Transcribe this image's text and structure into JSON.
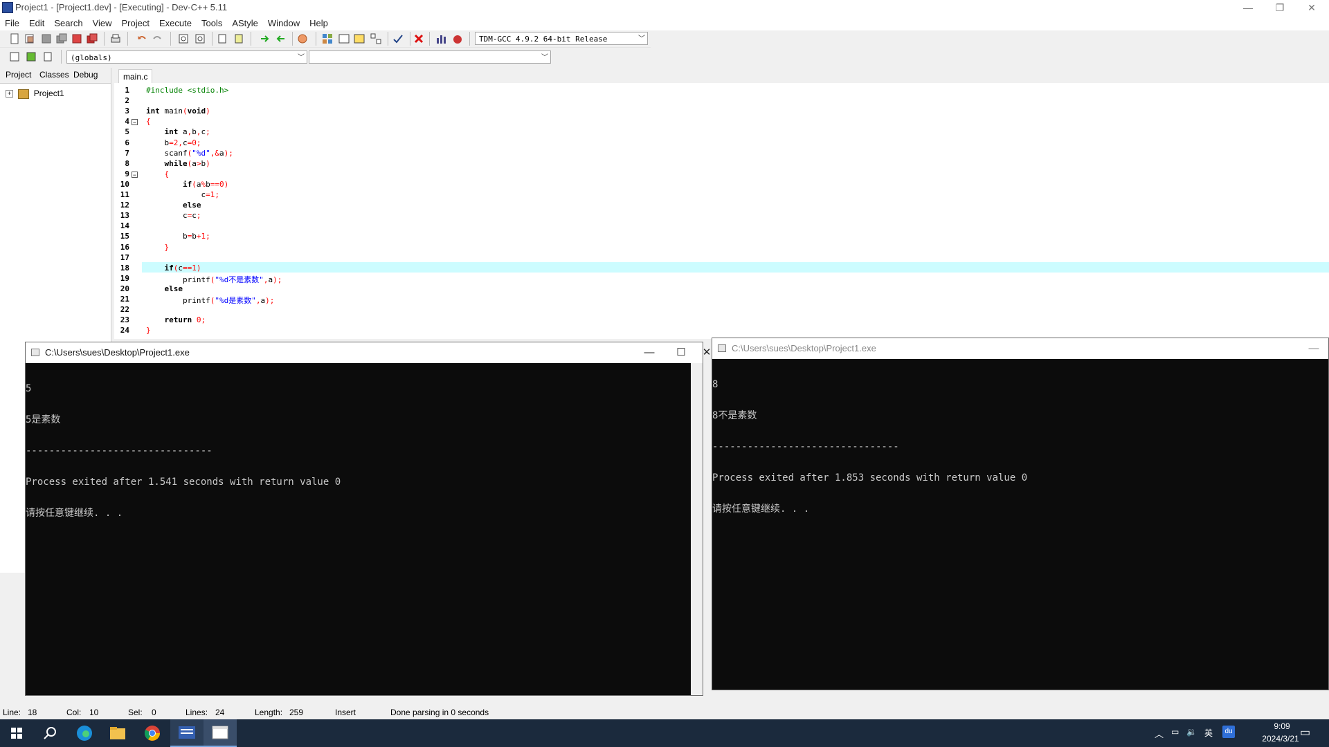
{
  "app": {
    "title": "Project1 - [Project1.dev] - [Executing] - Dev-C++ 5.11",
    "window_buttons": [
      "—",
      "❐",
      "✕"
    ]
  },
  "menu": [
    "File",
    "Edit",
    "Search",
    "View",
    "Project",
    "Execute",
    "Tools",
    "AStyle",
    "Window",
    "Help"
  ],
  "toolbar": {
    "compiler": "TDM-GCC 4.9.2 64-bit Release",
    "scope": "(globals)",
    "members": ""
  },
  "left_panel": {
    "tabs": [
      "Project",
      "Classes",
      "Debug"
    ],
    "tree_root": "Project1"
  },
  "editor": {
    "tab": "main.c",
    "lines": [
      "#include <stdio.h>",
      "",
      "int main(void)",
      "{",
      "    int a,b,c;",
      "    b=2,c=0;",
      "    scanf(\"%d\",&a);",
      "    while(a>b)",
      "    {",
      "        if(a%b==0)",
      "            c=1;",
      "        else",
      "        c=c;",
      "",
      "        b=b+1;",
      "    }",
      "",
      "    if(c==1)",
      "        printf(\"%d不是素数\",a);",
      "    else",
      "        printf(\"%d是素数\",a);",
      "",
      "    return 0;",
      "}"
    ],
    "current_line": 18
  },
  "console_left": {
    "title": "C:\\Users\\sues\\Desktop\\Project1.exe",
    "lines": [
      "5",
      "5是素数",
      "--------------------------------",
      "Process exited after 1.541 seconds with return value 0",
      "请按任意键继续. . ."
    ]
  },
  "console_right": {
    "title": "C:\\Users\\sues\\Desktop\\Project1.exe",
    "lines": [
      "8",
      "8不是素数",
      "--------------------------------",
      "Process exited after 1.853 seconds with return value 0",
      "请按任意键继续. . ."
    ]
  },
  "statusbar": {
    "line_label": "Line:",
    "line_value": "18",
    "col_label": "Col:",
    "col_value": "10",
    "sel_label": "Sel:",
    "sel_value": "0",
    "lines_label": "Lines:",
    "lines_value": "24",
    "length_label": "Length:",
    "length_value": "259",
    "mode": "Insert",
    "message": "Done parsing in 0 seconds"
  },
  "taskbar": {
    "time": "9:09",
    "date": "2024/3/21",
    "ime": "英",
    "baidu": "du"
  },
  "colors": {
    "keyword": "#000000",
    "string": "#0000ff",
    "number": "#ff0000",
    "preprocessor": "#008000",
    "current_line": "#ccfcff"
  }
}
